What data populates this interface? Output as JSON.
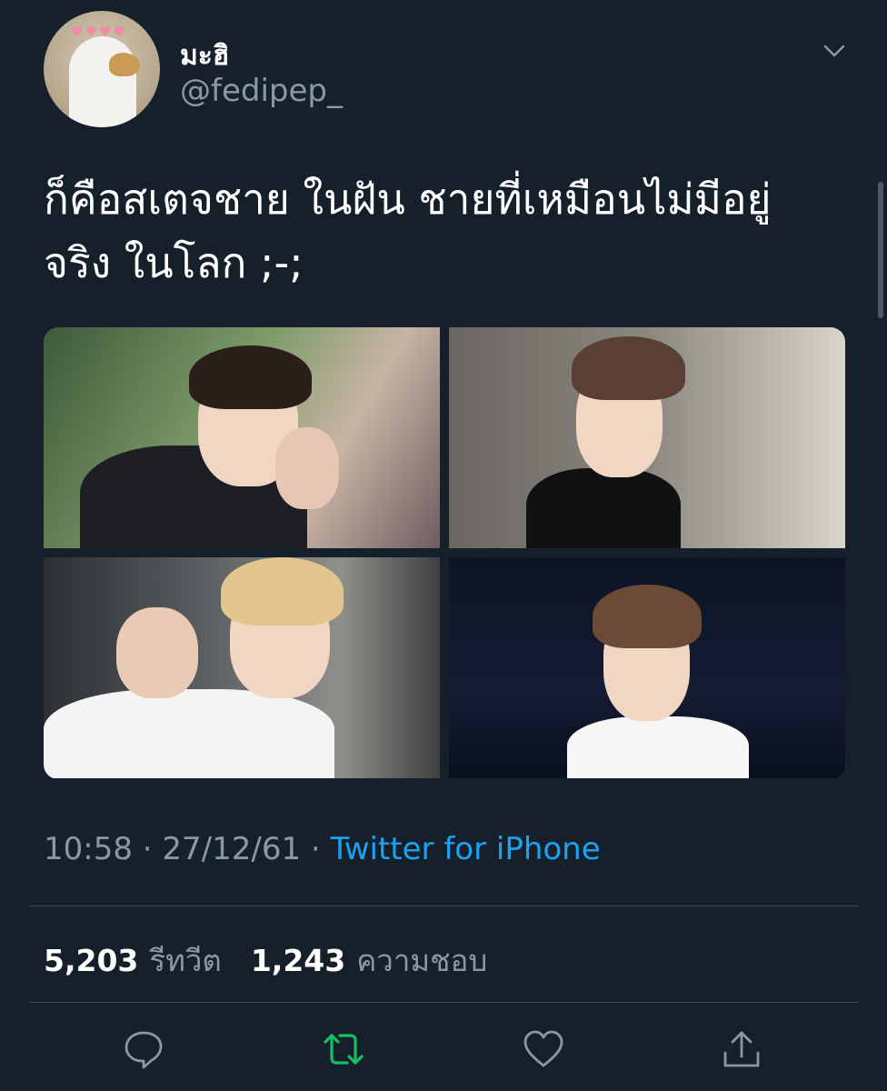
{
  "user": {
    "display_name": "มะฮิ",
    "handle": "@fedipep_",
    "avatar": "ghost-dog-avatar"
  },
  "tweet": {
    "text_line1": "ก็คือสเตจชาย ในฝัน ชายที่เหมือนไม่มีอยู่",
    "text_line2": "จริง ในโลก ;-;",
    "media": [
      {
        "name": "photo-1"
      },
      {
        "name": "photo-2"
      },
      {
        "name": "photo-3"
      },
      {
        "name": "photo-4"
      }
    ]
  },
  "meta": {
    "time": "10:58",
    "separator1": " · ",
    "date": "27/12/61",
    "separator2": " · ",
    "source": "Twitter for iPhone"
  },
  "stats": {
    "retweets_count": "5,203",
    "retweets_label": "รีทวีต",
    "likes_count": "1,243",
    "likes_label": "ความชอบ"
  },
  "actions": {
    "reply_icon": "reply-icon",
    "retweet_icon": "retweet-icon",
    "like_icon": "heart-icon",
    "share_icon": "share-icon"
  },
  "colors": {
    "background": "#15202b",
    "muted": "#8899a6",
    "accent": "#1da1f2",
    "retweet_green": "#17bf63",
    "divider": "#38444d"
  }
}
